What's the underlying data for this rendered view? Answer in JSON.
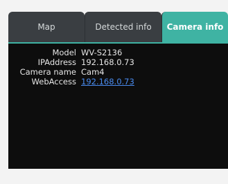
{
  "tabs": [
    {
      "label": "Map"
    },
    {
      "label": "Detected info"
    },
    {
      "label": "Camera info"
    }
  ],
  "active_tab": "Camera info",
  "camera_info": [
    {
      "label": "Model",
      "value": "WV-S2136"
    },
    {
      "label": "IPAddress",
      "value": "192.168.0.73"
    },
    {
      "label": "Camera name",
      "value": "Cam4"
    },
    {
      "label": "WebAccess",
      "value": "192.168.0.73"
    }
  ],
  "colors": {
    "accent": "#3fb3a3",
    "tab_inactive": "#3a3e42",
    "content_bg": "#0d0d0d",
    "link": "#4a8cf0"
  }
}
